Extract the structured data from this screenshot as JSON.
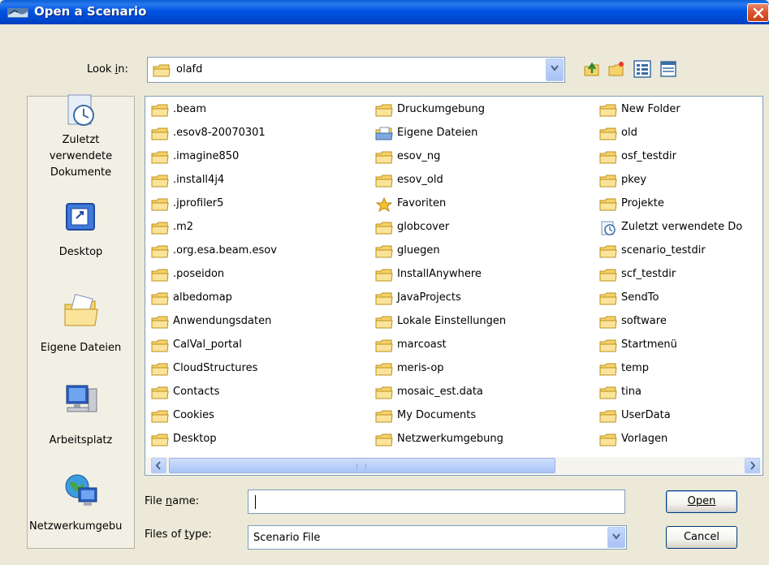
{
  "window": {
    "title": "Open a Scenario"
  },
  "look_in": {
    "label": "Look in:",
    "value": "olafd"
  },
  "places": [
    {
      "label_lines": [
        "Zuletzt",
        "verwendete",
        "Dokumente"
      ],
      "icon": "recent-documents-icon"
    },
    {
      "label_lines": [
        "Desktop"
      ],
      "icon": "desktop-icon"
    },
    {
      "label_lines": [
        "Eigene Dateien"
      ],
      "icon": "my-documents-icon"
    },
    {
      "label_lines": [
        "Arbeitsplatz"
      ],
      "icon": "my-computer-icon"
    },
    {
      "label_lines": [
        "Netzwerkumgebu"
      ],
      "icon": "network-icon"
    }
  ],
  "files": {
    "col1": [
      ".beam",
      ".esov8-20070301",
      ".imagine850",
      ".install4j4",
      ".jprofiler5",
      ".m2",
      ".org.esa.beam.esov",
      ".poseidon",
      "albedomap",
      "Anwendungsdaten",
      "CalVal_portal",
      "CloudStructures",
      "Contacts",
      "Cookies",
      "Desktop"
    ],
    "col2": [
      "Druckumgebung",
      "Eigene Dateien",
      "esov_ng",
      "esov_old",
      "Favoriten",
      "globcover",
      "gluegen",
      "InstallAnywhere",
      "JavaProjects",
      "Lokale Einstellungen",
      "marcoast",
      "meris-op",
      "mosaic_est.data",
      "My Documents",
      "Netzwerkumgebung"
    ],
    "col3": [
      "New Folder",
      "old",
      "osf_testdir",
      "pkey",
      "Projekte",
      "Zuletzt verwendete Do",
      "scenario_testdir",
      "scf_testdir",
      "SendTo",
      "software",
      "Startmenü",
      "temp",
      "tina",
      "UserData",
      "Vorlagen"
    ],
    "special_icons": {
      "Eigene Dateien": "document-folder-icon",
      "Favoriten": "star-icon",
      "Zuletzt verwendete Do": "recent-shortcut-icon"
    }
  },
  "file_name": {
    "label": "File name:",
    "value": ""
  },
  "file_type": {
    "label": "Files of type:",
    "value": "Scenario File"
  },
  "buttons": {
    "open": "Open",
    "cancel": "Cancel"
  },
  "colors": {
    "title_bar": "#0054e3",
    "dialog_bg": "#ece9d8",
    "folder": "#f7d26b",
    "border": "#7f9db9"
  }
}
